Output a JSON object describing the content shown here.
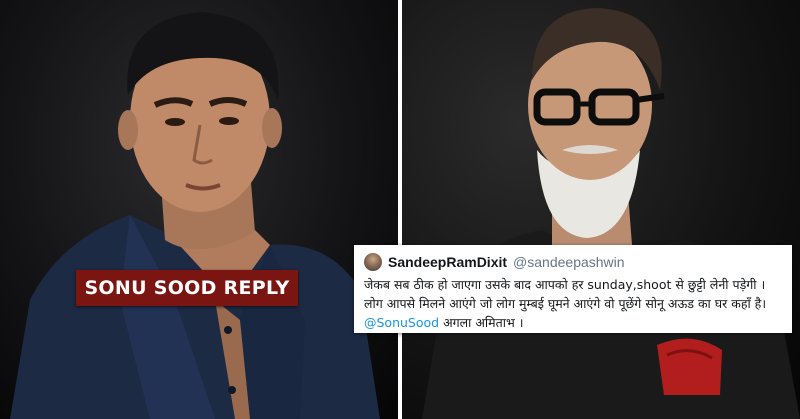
{
  "left_photo": {
    "subject": "sonu-sood-portrait",
    "label": "SONU SOOD REPLY",
    "label_bg": "#7a1512"
  },
  "right_photo": {
    "subject": "amitabh-bachchan-portrait"
  },
  "tweet": {
    "display_name": "SandeepRamDixit",
    "handle": "@sandeepashwin",
    "text_main": "जेकब सब ठीक हो जाएगा उसके बाद आपको हर sunday,shoot से छुट्टी लेनी पड़ेगी । लोग आपसे मिलने आएंगे जो लोग मुम्बई घूमने आएंगे वो पूछेंगे सोनू अऊड का घर कहाँ है।",
    "mention": "@SonuSood",
    "text_end": "अगला अमिताभ ।",
    "mention_color": "#1b95e0"
  }
}
